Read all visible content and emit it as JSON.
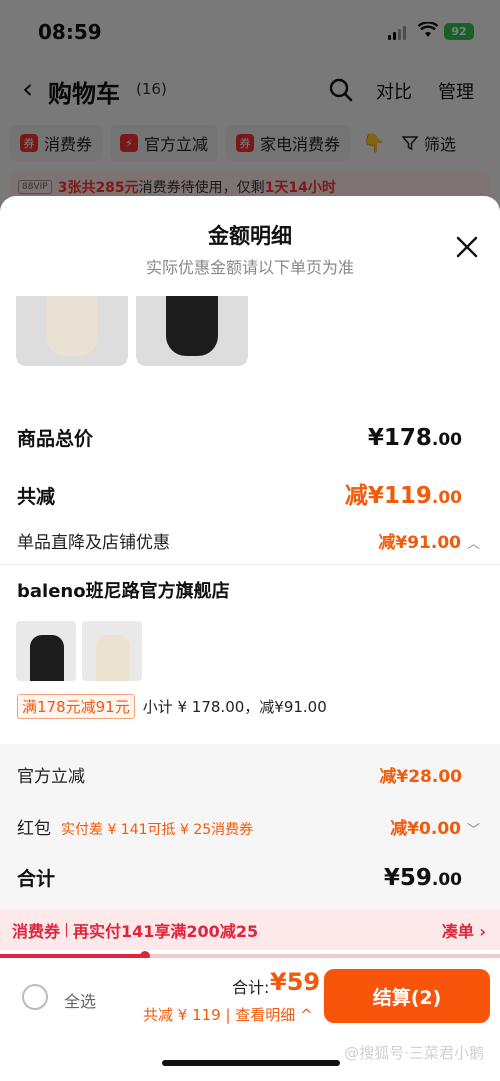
{
  "status_bar": {
    "time": "08:59",
    "battery": "92"
  },
  "nav": {
    "back_icon": "chevron-left-icon",
    "title": "购物车",
    "count": "(16)",
    "compare": "对比",
    "manage": "管理"
  },
  "chips": [
    {
      "label": "消费券",
      "icon": "coupon-icon"
    },
    {
      "label": "官方立减",
      "icon": "lightning-icon"
    },
    {
      "label": "家电消费券",
      "icon": "coupon-icon"
    },
    {
      "label": "筛选",
      "icon": "filter-icon"
    }
  ],
  "vip_bar": {
    "badge": "88VIP",
    "count": "3张共285元",
    "text": "消费券待使用，仅剩",
    "time_left": "1天14小时"
  },
  "sheet": {
    "title": "金额明细",
    "subtitle": "实际优惠金额请以下单页为准",
    "goods_total_label": "商品总价",
    "goods_total": "¥178",
    "goods_total_dec": ".00",
    "reduced_label": "共减",
    "reduced": "减¥119",
    "reduced_dec": ".00",
    "store_discount_label": "单品直降及店铺优惠",
    "store_discount": "减¥91.00",
    "shop": {
      "name": "baleno班尼路官方旗舰店",
      "promo_tag": "满178元减91元",
      "subtotal": "小计 ¥ 178.00，减¥91.00"
    },
    "official_label": "官方立减",
    "official": "减¥28.00",
    "redpacket_label": "红包",
    "redpacket_hint": "实付差 ¥ 141可抵 ¥ 25消费券",
    "redpacket": "减¥0.00",
    "sum_label": "合计",
    "sum": "¥59",
    "sum_dec": ".00"
  },
  "coupon_bar": {
    "tag": "消费券",
    "text": "再实付141享满200减25",
    "action": "凑单 ›",
    "progress_fraction": 0.29
  },
  "bottom": {
    "select_all": "全选",
    "total_label": "合计:",
    "total": "¥59",
    "reduce_line": "共减 ¥ 119 | 查看明细 ^",
    "checkout": "结算(2)",
    "watermark": "@搜狐号·三菜君小鹅"
  },
  "colors": {
    "accent": "#f8540a",
    "price": "#f25a0c",
    "coupon": "#e0243b"
  }
}
